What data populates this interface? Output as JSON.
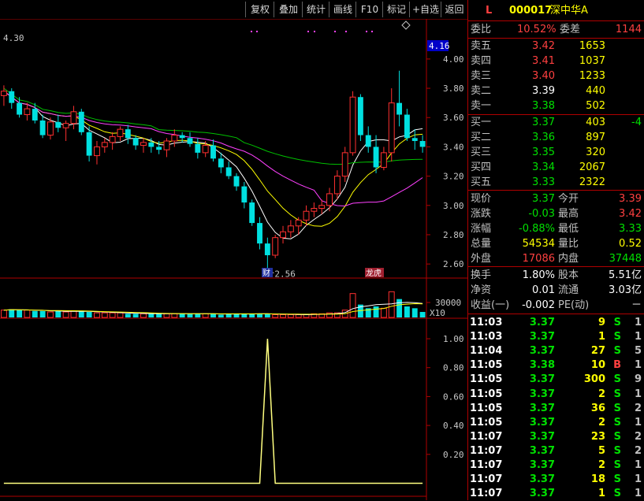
{
  "toolbar": {
    "buttons": [
      "复权",
      "叠加",
      "统计",
      "画线",
      "F10",
      "标记",
      "+自选",
      "返回"
    ]
  },
  "chart_data": [
    {
      "type": "candlestick",
      "title": "",
      "y_ticks": [
        "4.00",
        "3.80",
        "3.60",
        "3.40",
        "3.20",
        "3.00",
        "2.80",
        "2.60"
      ],
      "ylim": [
        2.52,
        4.22
      ],
      "top_left_label": "4.30",
      "current_price_tag": "4.16",
      "low_annotation": "2.56",
      "event_labels": [
        "财",
        "龙虎"
      ],
      "grid": false,
      "candles": [
        [
          3.75,
          3.82,
          3.68,
          3.78
        ],
        [
          3.78,
          3.8,
          3.66,
          3.7
        ],
        [
          3.7,
          3.74,
          3.6,
          3.62
        ],
        [
          3.62,
          3.7,
          3.58,
          3.66
        ],
        [
          3.66,
          3.7,
          3.56,
          3.58
        ],
        [
          3.58,
          3.62,
          3.46,
          3.48
        ],
        [
          3.48,
          3.6,
          3.45,
          3.57
        ],
        [
          3.57,
          3.62,
          3.5,
          3.53
        ],
        [
          3.53,
          3.58,
          3.44,
          3.56
        ],
        [
          3.56,
          3.68,
          3.52,
          3.64
        ],
        [
          3.64,
          3.66,
          3.48,
          3.5
        ],
        [
          3.5,
          3.54,
          3.3,
          3.34
        ],
        [
          3.34,
          3.44,
          3.28,
          3.4
        ],
        [
          3.4,
          3.46,
          3.36,
          3.43
        ],
        [
          3.43,
          3.5,
          3.38,
          3.47
        ],
        [
          3.47,
          3.54,
          3.44,
          3.52
        ],
        [
          3.52,
          3.55,
          3.42,
          3.46
        ],
        [
          3.46,
          3.48,
          3.38,
          3.41
        ],
        [
          3.41,
          3.46,
          3.36,
          3.43
        ],
        [
          3.43,
          3.46,
          3.36,
          3.4
        ],
        [
          3.4,
          3.44,
          3.35,
          3.38
        ],
        [
          3.38,
          3.46,
          3.33,
          3.44
        ],
        [
          3.44,
          3.52,
          3.4,
          3.48
        ],
        [
          3.48,
          3.5,
          3.43,
          3.46
        ],
        [
          3.46,
          3.5,
          3.4,
          3.42
        ],
        [
          3.42,
          3.46,
          3.32,
          3.36
        ],
        [
          3.36,
          3.44,
          3.33,
          3.41
        ],
        [
          3.41,
          3.45,
          3.3,
          3.32
        ],
        [
          3.32,
          3.36,
          3.22,
          3.26
        ],
        [
          3.26,
          3.3,
          3.18,
          3.2
        ],
        [
          3.2,
          3.22,
          3.1,
          3.13
        ],
        [
          3.13,
          3.16,
          2.98,
          3.02
        ],
        [
          3.02,
          3.04,
          2.86,
          2.88
        ],
        [
          2.88,
          2.92,
          2.7,
          2.74
        ],
        [
          2.74,
          2.78,
          2.56,
          2.66
        ],
        [
          2.66,
          2.8,
          2.64,
          2.78
        ],
        [
          2.78,
          2.86,
          2.74,
          2.82
        ],
        [
          2.82,
          2.9,
          2.78,
          2.86
        ],
        [
          2.86,
          2.92,
          2.8,
          2.9
        ],
        [
          2.9,
          3.0,
          2.86,
          2.96
        ],
        [
          2.96,
          3.02,
          2.92,
          2.98
        ],
        [
          2.98,
          3.04,
          2.94,
          3.0
        ],
        [
          3.0,
          3.12,
          2.96,
          3.08
        ],
        [
          3.08,
          3.24,
          3.04,
          3.2
        ],
        [
          3.2,
          3.4,
          3.16,
          3.36
        ],
        [
          3.36,
          3.78,
          3.34,
          3.74
        ],
        [
          3.74,
          3.76,
          3.44,
          3.48
        ],
        [
          3.48,
          3.54,
          3.36,
          3.4
        ],
        [
          3.4,
          3.48,
          3.22,
          3.26
        ],
        [
          3.26,
          3.4,
          3.24,
          3.36
        ],
        [
          3.36,
          3.8,
          3.3,
          3.7
        ],
        [
          3.7,
          3.92,
          3.54,
          3.62
        ],
        [
          3.62,
          3.66,
          3.44,
          3.46
        ],
        [
          3.46,
          3.52,
          3.38,
          3.44
        ],
        [
          3.44,
          3.48,
          3.36,
          3.4
        ]
      ]
    },
    {
      "type": "bar",
      "title": "",
      "y_ticks": [
        "30000"
      ],
      "multiplier_label": "X10",
      "values": [
        8,
        9,
        8,
        8,
        7,
        7,
        6,
        7,
        6,
        7,
        7,
        6,
        5,
        5,
        5,
        5,
        4,
        4,
        4,
        4,
        4,
        4,
        4,
        4,
        4,
        4,
        4,
        4,
        3,
        4,
        4,
        4,
        4,
        4,
        4,
        3,
        3,
        3,
        3,
        3,
        4,
        4,
        5,
        5,
        8,
        26,
        14,
        10,
        12,
        10,
        28,
        20,
        12,
        10,
        6
      ],
      "ylim": [
        0,
        30
      ]
    },
    {
      "type": "line",
      "title": "",
      "y_ticks": [
        "1.00",
        "0.80",
        "0.60",
        "0.40",
        "0.20"
      ],
      "ylim": [
        -0.09,
        1.12
      ],
      "spike_index": 34,
      "values_baseline": 0,
      "spike_value": 1.0
    }
  ],
  "quote": {
    "code_flag": "L",
    "stock_code": "000017",
    "stock_name": "深中华A",
    "ratio_label": "委比",
    "ratio_value": "10.52%",
    "diff_label": "委差",
    "diff_value": "1144",
    "asks": [
      {
        "label": "卖五",
        "price": "3.42",
        "vol": "1653",
        "chg": ""
      },
      {
        "label": "卖四",
        "price": "3.41",
        "vol": "1037",
        "chg": ""
      },
      {
        "label": "卖三",
        "price": "3.40",
        "vol": "1233",
        "chg": ""
      },
      {
        "label": "卖二",
        "price": "3.39",
        "vol": "440",
        "chg": ""
      },
      {
        "label": "卖一",
        "price": "3.38",
        "vol": "502",
        "chg": ""
      }
    ],
    "bids": [
      {
        "label": "买一",
        "price": "3.37",
        "vol": "403",
        "chg": "-4"
      },
      {
        "label": "买二",
        "price": "3.36",
        "vol": "897",
        "chg": ""
      },
      {
        "label": "买三",
        "price": "3.35",
        "vol": "320",
        "chg": ""
      },
      {
        "label": "买四",
        "price": "3.34",
        "vol": "2067",
        "chg": ""
      },
      {
        "label": "买五",
        "price": "3.33",
        "vol": "2322",
        "chg": ""
      }
    ],
    "stats": [
      {
        "l1": "现价",
        "v1": "3.37",
        "l2": "今开",
        "v2": "3.39"
      },
      {
        "l1": "涨跌",
        "v1": "-0.03",
        "l2": "最高",
        "v2": "3.42"
      },
      {
        "l1": "涨幅",
        "v1": "-0.88%",
        "l2": "最低",
        "v2": "3.33"
      },
      {
        "l1": "总量",
        "v1": "54534",
        "l2": "量比",
        "v2": "0.52"
      },
      {
        "l1": "外盘",
        "v1": "17086",
        "l2": "内盘",
        "v2": "37448"
      }
    ],
    "fundamentals": [
      {
        "l1": "换手",
        "v1": "1.80%",
        "l2": "股本",
        "v2": "5.51亿"
      },
      {
        "l1": "净资",
        "v1": "0.01",
        "l2": "流通",
        "v2": "3.03亿"
      },
      {
        "l1": "收益(一)",
        "v1": "-0.002",
        "l2": "PE(动)",
        "v2": "－"
      }
    ],
    "ticks": [
      {
        "time": "11:03",
        "price": "3.37",
        "vol": "9",
        "bs": "S",
        "n": "1"
      },
      {
        "time": "11:03",
        "price": "3.37",
        "vol": "1",
        "bs": "S",
        "n": "1"
      },
      {
        "time": "11:04",
        "price": "3.37",
        "vol": "27",
        "bs": "S",
        "n": "5"
      },
      {
        "time": "11:05",
        "price": "3.38",
        "vol": "10",
        "bs": "B",
        "n": "1"
      },
      {
        "time": "11:05",
        "price": "3.37",
        "vol": "300",
        "bs": "S",
        "n": "9"
      },
      {
        "time": "11:05",
        "price": "3.37",
        "vol": "2",
        "bs": "S",
        "n": "1"
      },
      {
        "time": "11:05",
        "price": "3.37",
        "vol": "36",
        "bs": "S",
        "n": "2"
      },
      {
        "time": "11:05",
        "price": "3.37",
        "vol": "2",
        "bs": "S",
        "n": "1"
      },
      {
        "time": "11:07",
        "price": "3.37",
        "vol": "23",
        "bs": "S",
        "n": "2"
      },
      {
        "time": "11:07",
        "price": "3.37",
        "vol": "5",
        "bs": "S",
        "n": "2"
      },
      {
        "time": "11:07",
        "price": "3.37",
        "vol": "2",
        "bs": "S",
        "n": "1"
      },
      {
        "time": "11:07",
        "price": "3.37",
        "vol": "18",
        "bs": "S",
        "n": "1"
      },
      {
        "time": "11:07",
        "price": "3.37",
        "vol": "1",
        "bs": "S",
        "n": "1"
      }
    ]
  }
}
